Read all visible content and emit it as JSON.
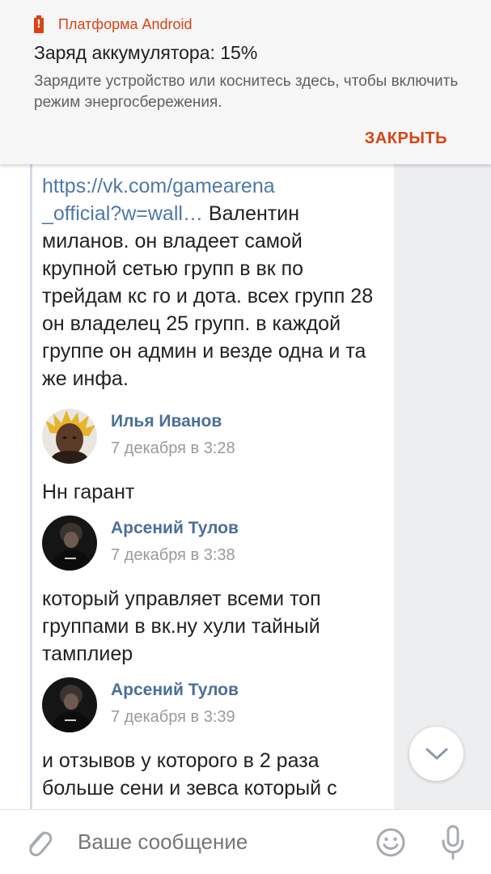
{
  "notification": {
    "app_name": "Платформа Android",
    "icon": "battery-alert-icon",
    "title": "Заряд аккумулятора: 15%",
    "text": "Зарядите устройство или коснитесь здесь, чтобы включить режим энергосбережения.",
    "close_label": "ЗАКРЫТЬ",
    "accent_color": "#d84315"
  },
  "post": {
    "link_text_line1": "https://vk.com/gamearena",
    "link_text_line2": "_official?w=wall…",
    "text_after_link": " Валентин миланов. он владеет самой крупной сетью групп в вк по трейдам кс го и дота. всех групп 28 он владелец 25 групп. в каждой группе он админ и везде одна и та же инфа."
  },
  "comments": [
    {
      "author": "Илья Иванов",
      "date": "7 декабря в 3:28",
      "text": "Нн гарант"
    },
    {
      "author": "Арсений Тулов",
      "date": "7 декабря в 3:38",
      "text": "который управляет всеми топ группами в вк.ну хули тайный тамплиер"
    },
    {
      "author": "Арсений Тулов",
      "date": "7 декабря в 3:39",
      "text": "и отзывов у которого в 2 раза больше сени и зевса который с"
    }
  ],
  "scroll_button": {
    "icon": "chevron-down-icon"
  },
  "composer": {
    "placeholder": "Ваше сообщение",
    "attach_icon": "paperclip-icon",
    "emoji_icon": "smile-icon",
    "mic_icon": "microphone-icon"
  },
  "colors": {
    "link": "#4f78a8",
    "author": "#4a6f9a",
    "background": "#edeef0"
  }
}
